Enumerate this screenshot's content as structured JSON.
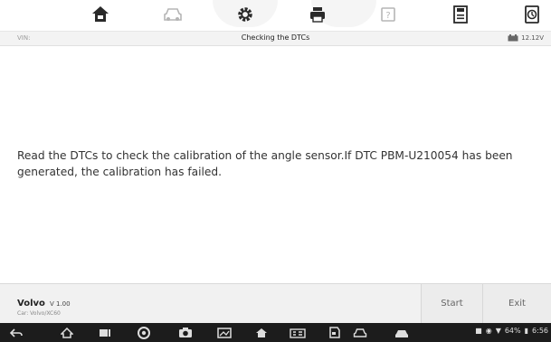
{
  "toolbar": {
    "icons": [
      "home-icon",
      "vehicle-icon",
      "settings-icon",
      "print-icon",
      "help-icon",
      "save-icon",
      "data-logging-icon"
    ]
  },
  "infobar": {
    "vin_label": "VIN:",
    "title": "Checking the DTCs",
    "voltage": "12.12V"
  },
  "main": {
    "message": "Read the DTCs to check the calibration of the angle sensor.If DTC PBM-U210054 has been generated, the calibration has failed."
  },
  "vehicle": {
    "make": "Volvo",
    "version": "V 1.00",
    "car": "Car: Volvo/XC60"
  },
  "buttons": {
    "start_label": "Start",
    "exit_label": "Exit"
  },
  "navbar": {
    "icons": [
      "back-icon",
      "home-icon",
      "recent-apps-icon",
      "chrome-icon",
      "camera-icon",
      "screenshot-icon",
      "maxifix-icon",
      "vci-icon",
      "shop-icon",
      "vehicle-menu-icon",
      "data-manager-icon"
    ]
  },
  "status": {
    "battery": "64%",
    "time": "6:56"
  },
  "colors": {
    "toolbar_icon": "#2a2a2a",
    "toolbar_icon_disabled": "#b5b5b5",
    "infobar_bg": "#f3f3f3",
    "bottombar_bg": "#f1f1f1",
    "navbar_bg": "#1c1c1c"
  }
}
